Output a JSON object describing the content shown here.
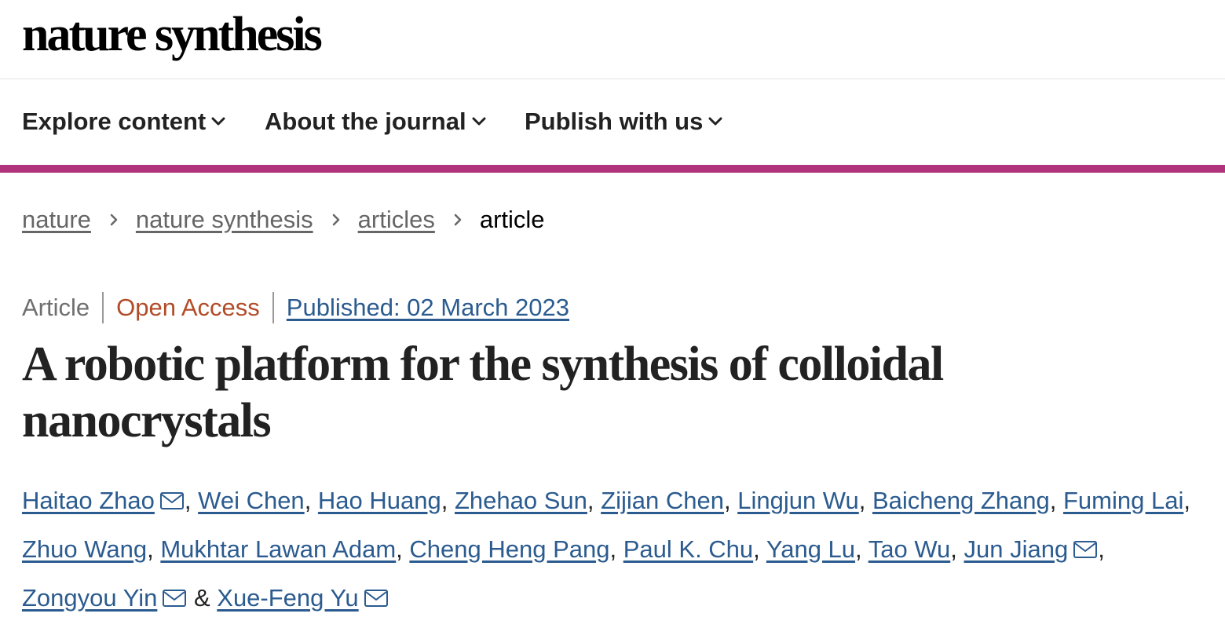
{
  "brand": {
    "logo_text": "nature synthesis"
  },
  "nav": {
    "items": [
      {
        "label": "Explore content",
        "icon": "chevron-down-icon"
      },
      {
        "label": "About the journal",
        "icon": "chevron-down-icon"
      },
      {
        "label": "Publish with us",
        "icon": "chevron-down-icon"
      }
    ]
  },
  "accent_color": "#b0337c",
  "breadcrumb": {
    "items": [
      "nature",
      "nature synthesis",
      "articles"
    ],
    "current": "article",
    "separator_icon": "chevron-right-icon"
  },
  "article": {
    "type": "Article",
    "access": "Open Access",
    "published": "Published: 02 March 2023",
    "title": "A robotic platform for the synthesis of colloidal nanocrystals",
    "authors": [
      {
        "name": "Haitao Zhao",
        "email_icon": true
      },
      {
        "name": "Wei Chen",
        "email_icon": false
      },
      {
        "name": "Hao Huang",
        "email_icon": false
      },
      {
        "name": "Zhehao Sun",
        "email_icon": false
      },
      {
        "name": "Zijian Chen",
        "email_icon": false
      },
      {
        "name": "Lingjun Wu",
        "email_icon": false
      },
      {
        "name": "Baicheng Zhang",
        "email_icon": false
      },
      {
        "name": "Fuming Lai",
        "email_icon": false
      },
      {
        "name": "Zhuo Wang",
        "email_icon": false
      },
      {
        "name": "Mukhtar Lawan Adam",
        "email_icon": false
      },
      {
        "name": "Cheng Heng Pang",
        "email_icon": false
      },
      {
        "name": "Paul K. Chu",
        "email_icon": false
      },
      {
        "name": "Yang Lu",
        "email_icon": false
      },
      {
        "name": "Tao Wu",
        "email_icon": false
      },
      {
        "name": "Jun Jiang",
        "email_icon": true
      },
      {
        "name": "Zongyou Yin",
        "email_icon": true
      },
      {
        "name": "Xue-Feng Yu",
        "email_icon": true
      }
    ],
    "author_separator": ", ",
    "author_final_separator": " & "
  },
  "colors": {
    "link": "#2b5b8f",
    "open_access": "#b24b27",
    "muted": "#6f6f6f"
  }
}
